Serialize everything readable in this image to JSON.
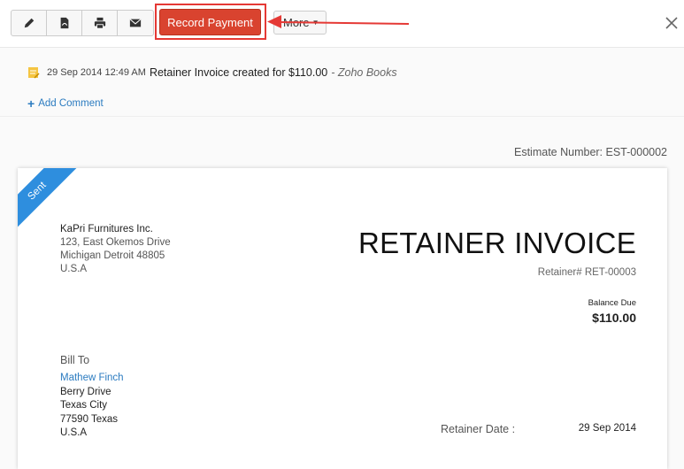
{
  "toolbar": {
    "icons": [
      "edit-icon",
      "pdf-icon",
      "print-icon",
      "mail-icon"
    ],
    "record_payment_label": "Record Payment",
    "more_label": "More"
  },
  "activity": {
    "timestamp": "29 Sep 2014 12:49 AM",
    "message": "Retainer Invoice created for $110.00",
    "source": "- Zoho Books",
    "add_comment_label": "Add Comment"
  },
  "estimate_number": "Estimate Number: EST-000002",
  "document": {
    "status_ribbon": "Sent",
    "company": {
      "name": "KaPri Furnitures Inc.",
      "address_line1": "123, East Okemos Drive",
      "address_line2": "Michigan Detroit 48805",
      "country": "U.S.A"
    },
    "title": "RETAINER INVOICE",
    "retainer_number": "Retainer# RET-00003",
    "balance_due_label": "Balance Due",
    "balance_due_value": "$110.00",
    "bill_to_label": "Bill To",
    "bill_to": {
      "customer": "Mathew Finch",
      "line1": "Berry Drive",
      "line2": "Texas City",
      "line3": "77590 Texas",
      "country": "U.S.A"
    },
    "retainer_date_label": "Retainer Date :",
    "retainer_date_value": "29 Sep 2014"
  },
  "colors": {
    "record_payment_bg": "#d9432f",
    "highlight_annotation": "#e53935",
    "ribbon": "#2e8ede",
    "link": "#2b7bc0"
  }
}
